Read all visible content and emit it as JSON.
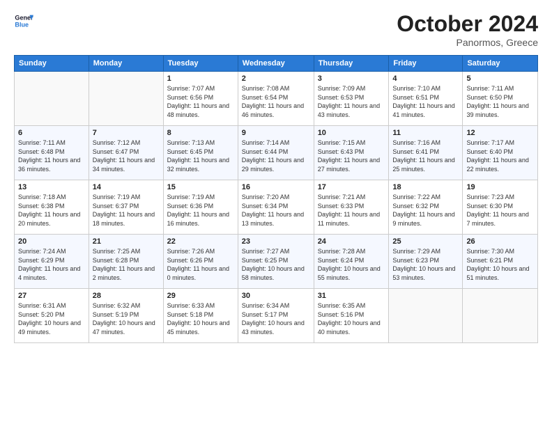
{
  "header": {
    "title": "October 2024",
    "subtitle": "Panormos, Greece"
  },
  "days": [
    "Sunday",
    "Monday",
    "Tuesday",
    "Wednesday",
    "Thursday",
    "Friday",
    "Saturday"
  ],
  "weeks": [
    [
      {
        "day": "",
        "info": ""
      },
      {
        "day": "",
        "info": ""
      },
      {
        "day": "1",
        "info": "Sunrise: 7:07 AM\nSunset: 6:56 PM\nDaylight: 11 hours\nand 48 minutes."
      },
      {
        "day": "2",
        "info": "Sunrise: 7:08 AM\nSunset: 6:54 PM\nDaylight: 11 hours\nand 46 minutes."
      },
      {
        "day": "3",
        "info": "Sunrise: 7:09 AM\nSunset: 6:53 PM\nDaylight: 11 hours\nand 43 minutes."
      },
      {
        "day": "4",
        "info": "Sunrise: 7:10 AM\nSunset: 6:51 PM\nDaylight: 11 hours\nand 41 minutes."
      },
      {
        "day": "5",
        "info": "Sunrise: 7:11 AM\nSunset: 6:50 PM\nDaylight: 11 hours\nand 39 minutes."
      }
    ],
    [
      {
        "day": "6",
        "info": "Sunrise: 7:11 AM\nSunset: 6:48 PM\nDaylight: 11 hours\nand 36 minutes."
      },
      {
        "day": "7",
        "info": "Sunrise: 7:12 AM\nSunset: 6:47 PM\nDaylight: 11 hours\nand 34 minutes."
      },
      {
        "day": "8",
        "info": "Sunrise: 7:13 AM\nSunset: 6:45 PM\nDaylight: 11 hours\nand 32 minutes."
      },
      {
        "day": "9",
        "info": "Sunrise: 7:14 AM\nSunset: 6:44 PM\nDaylight: 11 hours\nand 29 minutes."
      },
      {
        "day": "10",
        "info": "Sunrise: 7:15 AM\nSunset: 6:43 PM\nDaylight: 11 hours\nand 27 minutes."
      },
      {
        "day": "11",
        "info": "Sunrise: 7:16 AM\nSunset: 6:41 PM\nDaylight: 11 hours\nand 25 minutes."
      },
      {
        "day": "12",
        "info": "Sunrise: 7:17 AM\nSunset: 6:40 PM\nDaylight: 11 hours\nand 22 minutes."
      }
    ],
    [
      {
        "day": "13",
        "info": "Sunrise: 7:18 AM\nSunset: 6:38 PM\nDaylight: 11 hours\nand 20 minutes."
      },
      {
        "day": "14",
        "info": "Sunrise: 7:19 AM\nSunset: 6:37 PM\nDaylight: 11 hours\nand 18 minutes."
      },
      {
        "day": "15",
        "info": "Sunrise: 7:19 AM\nSunset: 6:36 PM\nDaylight: 11 hours\nand 16 minutes."
      },
      {
        "day": "16",
        "info": "Sunrise: 7:20 AM\nSunset: 6:34 PM\nDaylight: 11 hours\nand 13 minutes."
      },
      {
        "day": "17",
        "info": "Sunrise: 7:21 AM\nSunset: 6:33 PM\nDaylight: 11 hours\nand 11 minutes."
      },
      {
        "day": "18",
        "info": "Sunrise: 7:22 AM\nSunset: 6:32 PM\nDaylight: 11 hours\nand 9 minutes."
      },
      {
        "day": "19",
        "info": "Sunrise: 7:23 AM\nSunset: 6:30 PM\nDaylight: 11 hours\nand 7 minutes."
      }
    ],
    [
      {
        "day": "20",
        "info": "Sunrise: 7:24 AM\nSunset: 6:29 PM\nDaylight: 11 hours\nand 4 minutes."
      },
      {
        "day": "21",
        "info": "Sunrise: 7:25 AM\nSunset: 6:28 PM\nDaylight: 11 hours\nand 2 minutes."
      },
      {
        "day": "22",
        "info": "Sunrise: 7:26 AM\nSunset: 6:26 PM\nDaylight: 11 hours\nand 0 minutes."
      },
      {
        "day": "23",
        "info": "Sunrise: 7:27 AM\nSunset: 6:25 PM\nDaylight: 10 hours\nand 58 minutes."
      },
      {
        "day": "24",
        "info": "Sunrise: 7:28 AM\nSunset: 6:24 PM\nDaylight: 10 hours\nand 55 minutes."
      },
      {
        "day": "25",
        "info": "Sunrise: 7:29 AM\nSunset: 6:23 PM\nDaylight: 10 hours\nand 53 minutes."
      },
      {
        "day": "26",
        "info": "Sunrise: 7:30 AM\nSunset: 6:21 PM\nDaylight: 10 hours\nand 51 minutes."
      }
    ],
    [
      {
        "day": "27",
        "info": "Sunrise: 6:31 AM\nSunset: 5:20 PM\nDaylight: 10 hours\nand 49 minutes."
      },
      {
        "day": "28",
        "info": "Sunrise: 6:32 AM\nSunset: 5:19 PM\nDaylight: 10 hours\nand 47 minutes."
      },
      {
        "day": "29",
        "info": "Sunrise: 6:33 AM\nSunset: 5:18 PM\nDaylight: 10 hours\nand 45 minutes."
      },
      {
        "day": "30",
        "info": "Sunrise: 6:34 AM\nSunset: 5:17 PM\nDaylight: 10 hours\nand 43 minutes."
      },
      {
        "day": "31",
        "info": "Sunrise: 6:35 AM\nSunset: 5:16 PM\nDaylight: 10 hours\nand 40 minutes."
      },
      {
        "day": "",
        "info": ""
      },
      {
        "day": "",
        "info": ""
      }
    ]
  ]
}
